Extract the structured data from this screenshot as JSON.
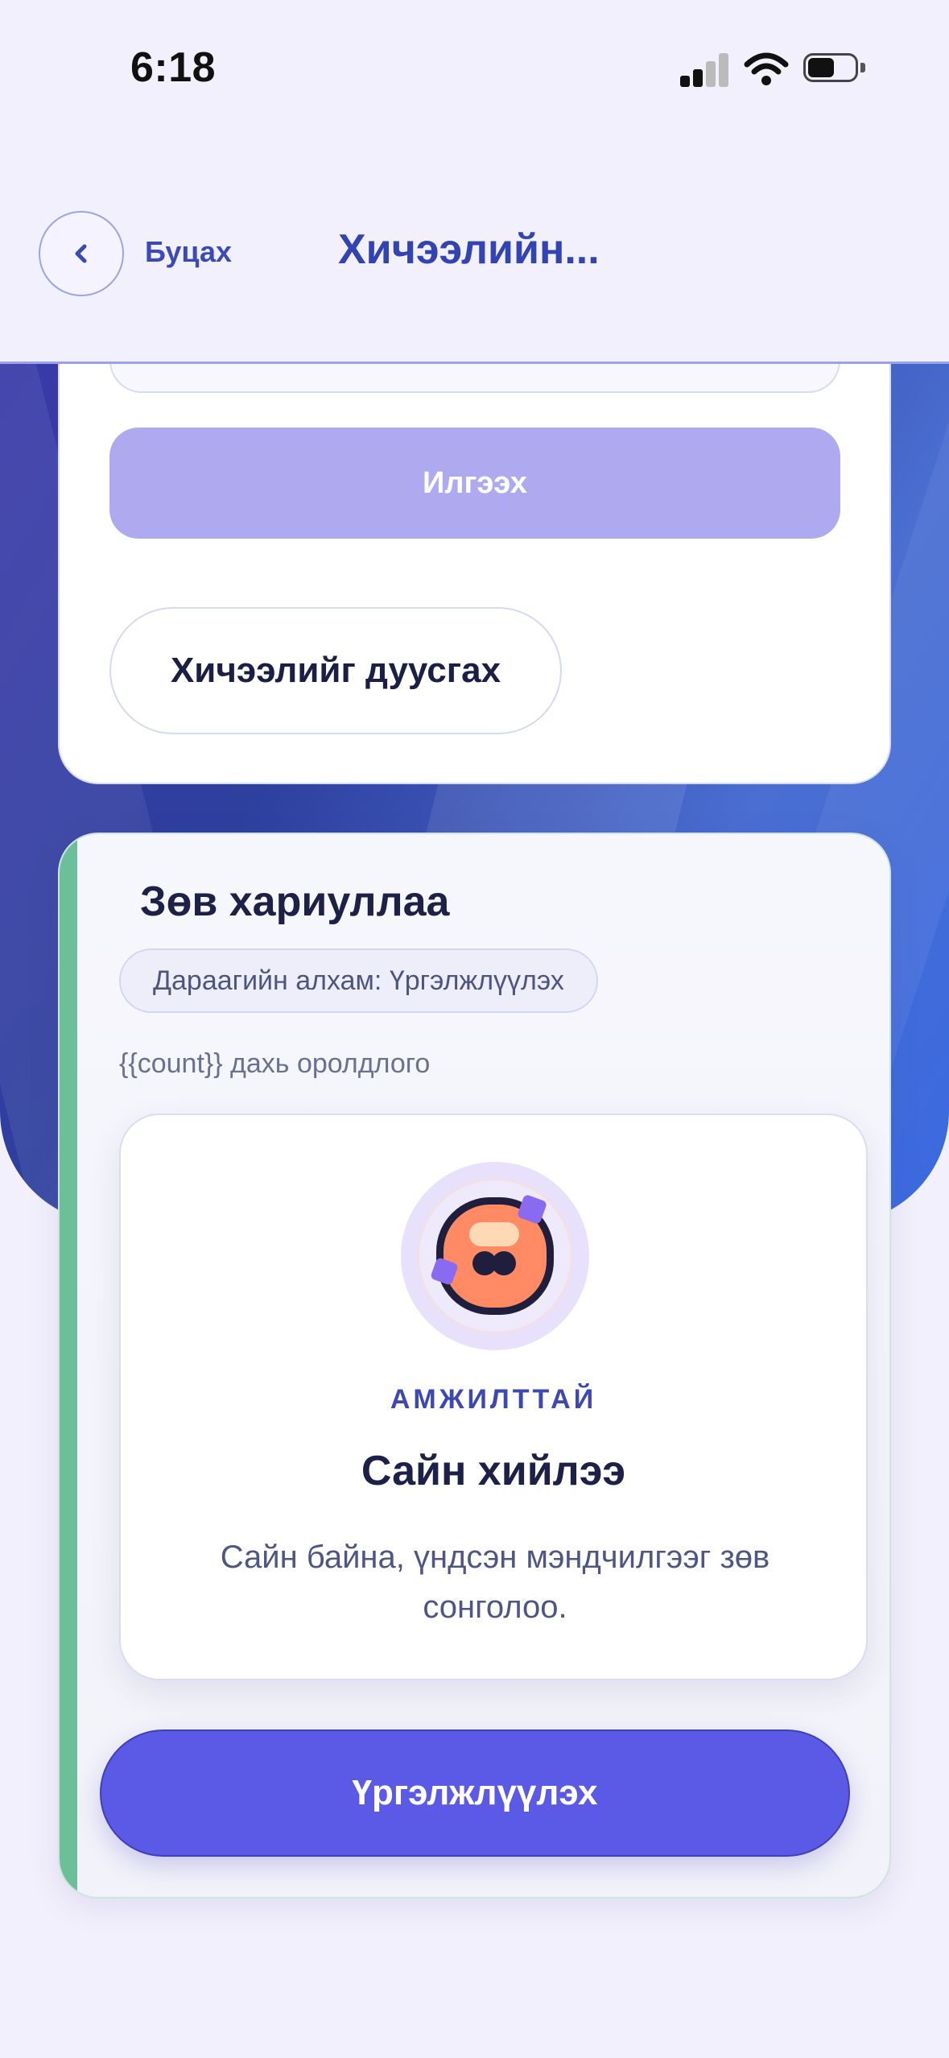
{
  "status_bar": {
    "time": "6:18"
  },
  "header": {
    "back_label": "Буцах",
    "title": "Хичээлийн..."
  },
  "top_card": {
    "send_label": "Илгээх",
    "finish_label": "Хичээлийг дуусгах"
  },
  "result": {
    "title": "Зөв хариуллаа",
    "next_step": "Дараагийн алхам: Үргэлжлүүлэх",
    "attempt": "{{count}} дахь оролдлого",
    "status_label": "АМЖИЛТТАЙ",
    "feedback_title": "Сайн хийлээ",
    "feedback_message": "Сайн байна, үндсэн мэндчилгээг зөв сонголоо.",
    "continue_label": "Үргэлжлүүлэх"
  },
  "colors": {
    "accent": "#5a5ae6",
    "success_bar": "#6dbf9a",
    "title_blue": "#3244b4"
  }
}
